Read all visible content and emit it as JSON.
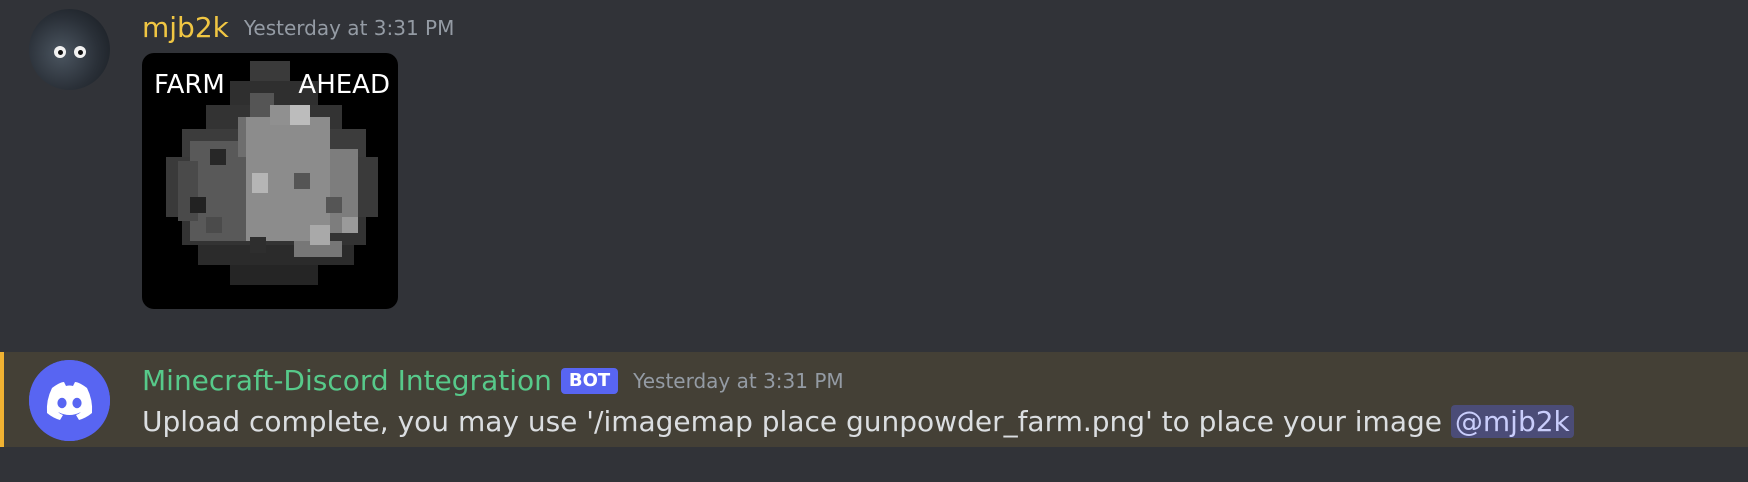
{
  "messages": [
    {
      "author": "mjb2k",
      "timestamp": "Yesterday at 3:31 PM",
      "attachment": {
        "caption_left": "FARM",
        "caption_right": "AHEAD",
        "icon": "gunpowder-pixel-art"
      }
    },
    {
      "author": "Minecraft-Discord Integration",
      "badge": "BOT",
      "timestamp": "Yesterday at 3:31 PM",
      "text": "Upload complete, you may use '/imagemap place gunpowder_farm.png' to place your image",
      "mention": "@mjb2k",
      "highlighted": true
    }
  ],
  "colors": {
    "background": "#313338",
    "highlight_background": "#444036",
    "highlight_bar": "#f0b232",
    "user_name": "#f0c643",
    "bot_name": "#57c98a",
    "bot_badge": "#5865f2",
    "timestamp": "#949ba4",
    "text": "#dbdee1"
  }
}
